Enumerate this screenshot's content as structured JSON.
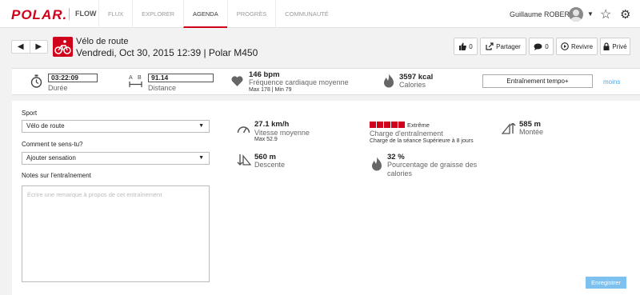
{
  "nav": {
    "logo": "POLAR.",
    "product": "FLOW",
    "tabs": [
      {
        "label": "FLUX"
      },
      {
        "label": "EXPLORER"
      },
      {
        "label": "AGENDA"
      },
      {
        "label": "PROGRÈS"
      },
      {
        "label": "COMMUNAUTÉ"
      }
    ],
    "active_tab": "AGENDA",
    "user_name": "Guillaume ROBERT",
    "accent_color": "#d0021b"
  },
  "activity": {
    "sport_name": "Vélo de route",
    "date_line": "Vendredi, Oct 30, 2015 12:39 | Polar M450",
    "buttons": {
      "like_count": "0",
      "share_label": "Partager",
      "comment_count": "0",
      "replay_label": "Revivre",
      "privacy_label": "Privé"
    }
  },
  "summary": {
    "duration_value": "03:22:09",
    "duration_label": "Durée",
    "distance_value": "91.14",
    "distance_label": "Distance",
    "hr_value": "146 bpm",
    "hr_label": "Fréquence cardiaque moyenne",
    "hr_minmax": "Max 178  |  Min 79",
    "calories_value": "3597 kcal",
    "calories_label": "Calories",
    "tempo_button": "Entraînement tempo+",
    "less_link": "moins"
  },
  "form": {
    "sport_label": "Sport",
    "sport_value": "Vélo de route",
    "feeling_label": "Comment te sens-tu?",
    "feeling_value": "Ajouter sensation",
    "notes_label": "Notes sur l'entraînement",
    "notes_placeholder": "Écrire une remarque à propos de cet entraînement",
    "save_button": "Enregistrer"
  },
  "metrics": {
    "speed_value": "27.1 km/h",
    "speed_label": "Vitesse moyenne",
    "speed_max": "Max 52.9",
    "descent_value": "560 m",
    "descent_label": "Descente",
    "load_level": "Extrême",
    "load_dots": 5,
    "load_label": "Charge d'entraînement",
    "load_detail": "Charge de la séance Supérieure à 8 jours",
    "fat_value": "32 %",
    "fat_label_1": "Pourcentage de graisse des",
    "fat_label_2": "calories",
    "ascent_value": "585 m",
    "ascent_label": "Montée"
  }
}
